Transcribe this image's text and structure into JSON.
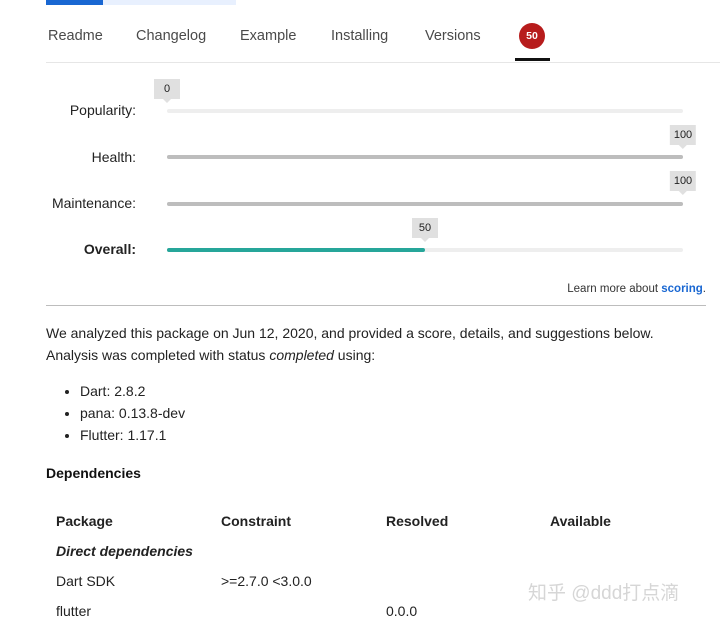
{
  "tabs": [
    {
      "label": "Readme"
    },
    {
      "label": "Changelog"
    },
    {
      "label": "Example"
    },
    {
      "label": "Installing"
    },
    {
      "label": "Versions"
    }
  ],
  "score_tab": {
    "value": "50"
  },
  "scores": {
    "popularity": {
      "label": "Popularity:",
      "value": 0,
      "bubble": "0"
    },
    "health": {
      "label": "Health:",
      "value": 100,
      "bubble": "100"
    },
    "maintenance": {
      "label": "Maintenance:",
      "value": 100,
      "bubble": "100"
    },
    "overall": {
      "label": "Overall:",
      "value": 50,
      "bubble": "50"
    }
  },
  "learn_more": {
    "prefix": "Learn more about ",
    "link": "scoring",
    "suffix": "."
  },
  "analysis": {
    "part1": "We analyzed this package on Jun 12, 2020, and provided a score, details, and suggestions below. Analysis was completed with status ",
    "status": "completed",
    "part2": " using:"
  },
  "tools": [
    "Dart: 2.8.2",
    "pana: 0.13.8-dev",
    "Flutter: 1.17.1"
  ],
  "dependencies": {
    "heading": "Dependencies",
    "columns": [
      "Package",
      "Constraint",
      "Resolved",
      "Available"
    ],
    "group_label": "Direct dependencies",
    "rows": [
      {
        "package": "Dart SDK",
        "constraint": ">=2.7.0 <3.0.0",
        "resolved": "",
        "available": ""
      },
      {
        "package": "flutter",
        "constraint": "",
        "resolved": "0.0.0",
        "available": ""
      }
    ]
  },
  "watermark": "知乎 @ddd打点滴",
  "colors": {
    "brand_blue": "#1967d2",
    "score_red": "#b71c1c",
    "overall_teal": "#26a69a"
  }
}
